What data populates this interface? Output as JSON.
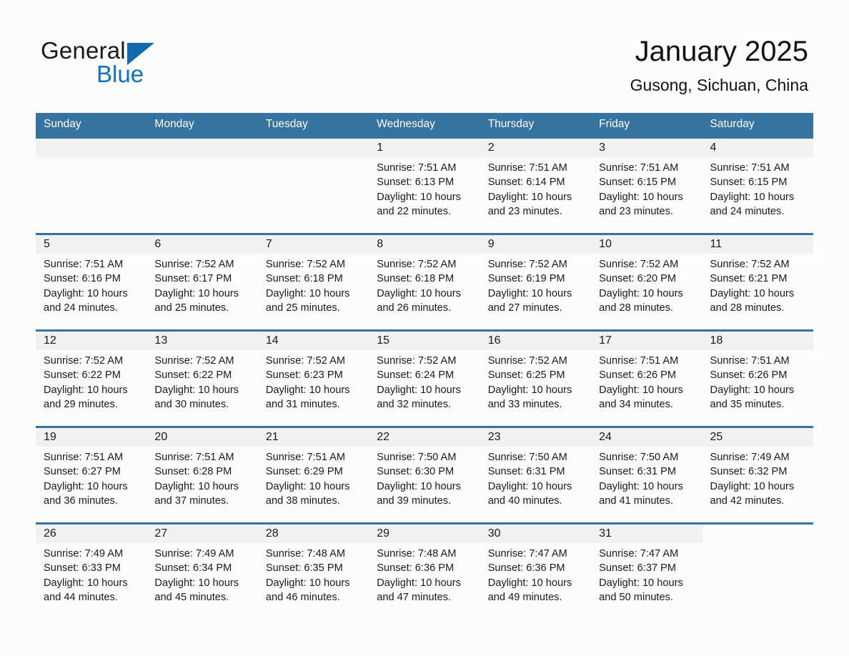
{
  "brand": {
    "name_part1": "General",
    "name_part2": "Blue",
    "triangle_icon": "triangle-icon",
    "colors": {
      "blue": "#1072be",
      "dark": "#1a1a1a"
    }
  },
  "header": {
    "title": "January 2025",
    "subtitle": "Gusong, Sichuan, China"
  },
  "colors": {
    "header_bg": "#36739f",
    "daynum_band": "#f1f1f1",
    "page_bg": "#fcfcfc",
    "text": "#1a1a1a"
  },
  "weekday_headers": [
    "Sunday",
    "Monday",
    "Tuesday",
    "Wednesday",
    "Thursday",
    "Friday",
    "Saturday"
  ],
  "weeks": [
    [
      {
        "day": "",
        "lines": []
      },
      {
        "day": "",
        "lines": []
      },
      {
        "day": "",
        "lines": []
      },
      {
        "day": "1",
        "lines": [
          "Sunrise: 7:51 AM",
          "Sunset: 6:13 PM",
          "Daylight: 10 hours",
          "and 22 minutes."
        ]
      },
      {
        "day": "2",
        "lines": [
          "Sunrise: 7:51 AM",
          "Sunset: 6:14 PM",
          "Daylight: 10 hours",
          "and 23 minutes."
        ]
      },
      {
        "day": "3",
        "lines": [
          "Sunrise: 7:51 AM",
          "Sunset: 6:15 PM",
          "Daylight: 10 hours",
          "and 23 minutes."
        ]
      },
      {
        "day": "4",
        "lines": [
          "Sunrise: 7:51 AM",
          "Sunset: 6:15 PM",
          "Daylight: 10 hours",
          "and 24 minutes."
        ]
      }
    ],
    [
      {
        "day": "5",
        "lines": [
          "Sunrise: 7:51 AM",
          "Sunset: 6:16 PM",
          "Daylight: 10 hours",
          "and 24 minutes."
        ]
      },
      {
        "day": "6",
        "lines": [
          "Sunrise: 7:52 AM",
          "Sunset: 6:17 PM",
          "Daylight: 10 hours",
          "and 25 minutes."
        ]
      },
      {
        "day": "7",
        "lines": [
          "Sunrise: 7:52 AM",
          "Sunset: 6:18 PM",
          "Daylight: 10 hours",
          "and 25 minutes."
        ]
      },
      {
        "day": "8",
        "lines": [
          "Sunrise: 7:52 AM",
          "Sunset: 6:18 PM",
          "Daylight: 10 hours",
          "and 26 minutes."
        ]
      },
      {
        "day": "9",
        "lines": [
          "Sunrise: 7:52 AM",
          "Sunset: 6:19 PM",
          "Daylight: 10 hours",
          "and 27 minutes."
        ]
      },
      {
        "day": "10",
        "lines": [
          "Sunrise: 7:52 AM",
          "Sunset: 6:20 PM",
          "Daylight: 10 hours",
          "and 28 minutes."
        ]
      },
      {
        "day": "11",
        "lines": [
          "Sunrise: 7:52 AM",
          "Sunset: 6:21 PM",
          "Daylight: 10 hours",
          "and 28 minutes."
        ]
      }
    ],
    [
      {
        "day": "12",
        "lines": [
          "Sunrise: 7:52 AM",
          "Sunset: 6:22 PM",
          "Daylight: 10 hours",
          "and 29 minutes."
        ]
      },
      {
        "day": "13",
        "lines": [
          "Sunrise: 7:52 AM",
          "Sunset: 6:22 PM",
          "Daylight: 10 hours",
          "and 30 minutes."
        ]
      },
      {
        "day": "14",
        "lines": [
          "Sunrise: 7:52 AM",
          "Sunset: 6:23 PM",
          "Daylight: 10 hours",
          "and 31 minutes."
        ]
      },
      {
        "day": "15",
        "lines": [
          "Sunrise: 7:52 AM",
          "Sunset: 6:24 PM",
          "Daylight: 10 hours",
          "and 32 minutes."
        ]
      },
      {
        "day": "16",
        "lines": [
          "Sunrise: 7:52 AM",
          "Sunset: 6:25 PM",
          "Daylight: 10 hours",
          "and 33 minutes."
        ]
      },
      {
        "day": "17",
        "lines": [
          "Sunrise: 7:51 AM",
          "Sunset: 6:26 PM",
          "Daylight: 10 hours",
          "and 34 minutes."
        ]
      },
      {
        "day": "18",
        "lines": [
          "Sunrise: 7:51 AM",
          "Sunset: 6:26 PM",
          "Daylight: 10 hours",
          "and 35 minutes."
        ]
      }
    ],
    [
      {
        "day": "19",
        "lines": [
          "Sunrise: 7:51 AM",
          "Sunset: 6:27 PM",
          "Daylight: 10 hours",
          "and 36 minutes."
        ]
      },
      {
        "day": "20",
        "lines": [
          "Sunrise: 7:51 AM",
          "Sunset: 6:28 PM",
          "Daylight: 10 hours",
          "and 37 minutes."
        ]
      },
      {
        "day": "21",
        "lines": [
          "Sunrise: 7:51 AM",
          "Sunset: 6:29 PM",
          "Daylight: 10 hours",
          "and 38 minutes."
        ]
      },
      {
        "day": "22",
        "lines": [
          "Sunrise: 7:50 AM",
          "Sunset: 6:30 PM",
          "Daylight: 10 hours",
          "and 39 minutes."
        ]
      },
      {
        "day": "23",
        "lines": [
          "Sunrise: 7:50 AM",
          "Sunset: 6:31 PM",
          "Daylight: 10 hours",
          "and 40 minutes."
        ]
      },
      {
        "day": "24",
        "lines": [
          "Sunrise: 7:50 AM",
          "Sunset: 6:31 PM",
          "Daylight: 10 hours",
          "and 41 minutes."
        ]
      },
      {
        "day": "25",
        "lines": [
          "Sunrise: 7:49 AM",
          "Sunset: 6:32 PM",
          "Daylight: 10 hours",
          "and 42 minutes."
        ]
      }
    ],
    [
      {
        "day": "26",
        "lines": [
          "Sunrise: 7:49 AM",
          "Sunset: 6:33 PM",
          "Daylight: 10 hours",
          "and 44 minutes."
        ]
      },
      {
        "day": "27",
        "lines": [
          "Sunrise: 7:49 AM",
          "Sunset: 6:34 PM",
          "Daylight: 10 hours",
          "and 45 minutes."
        ]
      },
      {
        "day": "28",
        "lines": [
          "Sunrise: 7:48 AM",
          "Sunset: 6:35 PM",
          "Daylight: 10 hours",
          "and 46 minutes."
        ]
      },
      {
        "day": "29",
        "lines": [
          "Sunrise: 7:48 AM",
          "Sunset: 6:36 PM",
          "Daylight: 10 hours",
          "and 47 minutes."
        ]
      },
      {
        "day": "30",
        "lines": [
          "Sunrise: 7:47 AM",
          "Sunset: 6:36 PM",
          "Daylight: 10 hours",
          "and 49 minutes."
        ]
      },
      {
        "day": "31",
        "lines": [
          "Sunrise: 7:47 AM",
          "Sunset: 6:37 PM",
          "Daylight: 10 hours",
          "and 50 minutes."
        ]
      },
      {
        "day": "",
        "lines": [],
        "blank": true
      }
    ]
  ]
}
